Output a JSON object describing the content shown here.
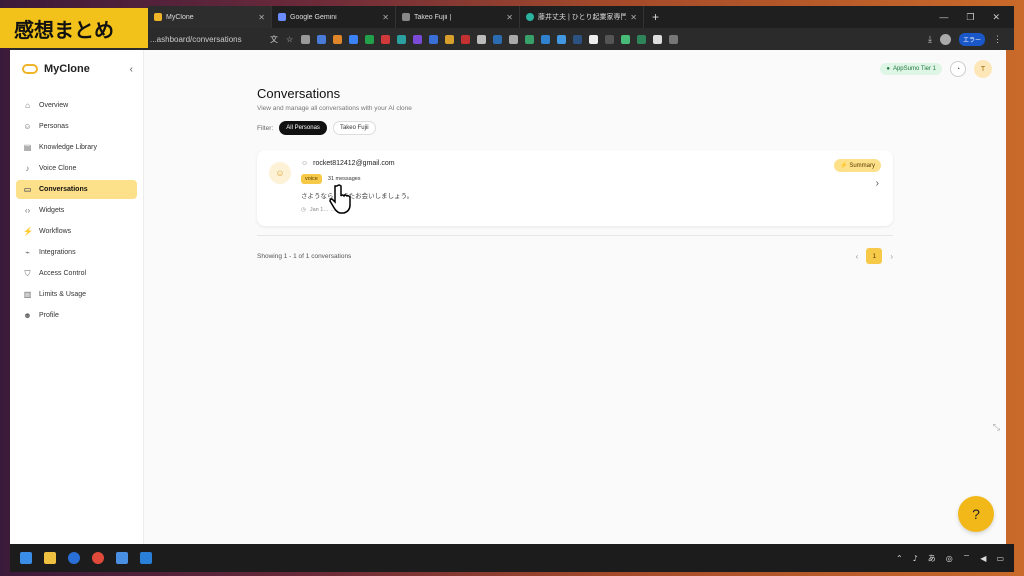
{
  "overlay": {
    "title": "感想まとめ"
  },
  "browser": {
    "tabs": [
      {
        "label": "MyClone",
        "active": true
      },
      {
        "label": "Google Gemini",
        "active": false
      },
      {
        "label": "Takeo Fujii |",
        "active": false
      },
      {
        "label": "藤井丈夫 | ひとり起業家専門の...",
        "active": false
      }
    ],
    "new_tab": "+",
    "url": "...ashboard/conversations",
    "profile": "エラー"
  },
  "sidebar": {
    "brand": "MyClone",
    "collapse": "‹",
    "items": [
      {
        "label": "Overview",
        "icon": "home-icon",
        "glyph": "⌂",
        "active": false
      },
      {
        "label": "Personas",
        "icon": "users-icon",
        "glyph": "☺",
        "active": false
      },
      {
        "label": "Knowledge Library",
        "icon": "book-icon",
        "glyph": "▤",
        "active": false
      },
      {
        "label": "Voice Clone",
        "icon": "mic-icon",
        "glyph": "♪",
        "active": false
      },
      {
        "label": "Conversations",
        "icon": "chat-icon",
        "glyph": "▭",
        "active": true
      },
      {
        "label": "Widgets",
        "icon": "code-icon",
        "glyph": "‹›",
        "active": false
      },
      {
        "label": "Workflows",
        "icon": "workflow-icon",
        "glyph": "⚡",
        "active": false
      },
      {
        "label": "Integrations",
        "icon": "plug-icon",
        "glyph": "⌁",
        "active": false
      },
      {
        "label": "Access Control",
        "icon": "shield-icon",
        "glyph": "⛉",
        "active": false
      },
      {
        "label": "Limits & Usage",
        "icon": "bar-chart-icon",
        "glyph": "▥",
        "active": false
      },
      {
        "label": "Profile",
        "icon": "user-icon",
        "glyph": "☻",
        "active": false
      }
    ]
  },
  "header": {
    "tier_badge": "AppSumo Tier 1",
    "avatar_initial": "T"
  },
  "main": {
    "title": "Conversations",
    "subtitle": "View and manage all conversations with your AI clone",
    "filter_label": "Filter:",
    "filters": [
      {
        "label": "All Personas",
        "selected": true
      },
      {
        "label": "Takeo Fujii",
        "selected": false
      }
    ],
    "conversation": {
      "email": "rocket812412@gmail.com",
      "tag": "voice",
      "messages": "31 messages",
      "preview": "さようなら！ またお会いしましょう。",
      "time": "Jan 1…   …4 AM",
      "summary_label": "Summary"
    },
    "showing": "Showing 1 - 1 of 1 conversations",
    "current_page": "1"
  },
  "colors": {
    "accent": "#f7c948",
    "active_nav": "#fde08a",
    "badge_green": "#dff5e6"
  }
}
